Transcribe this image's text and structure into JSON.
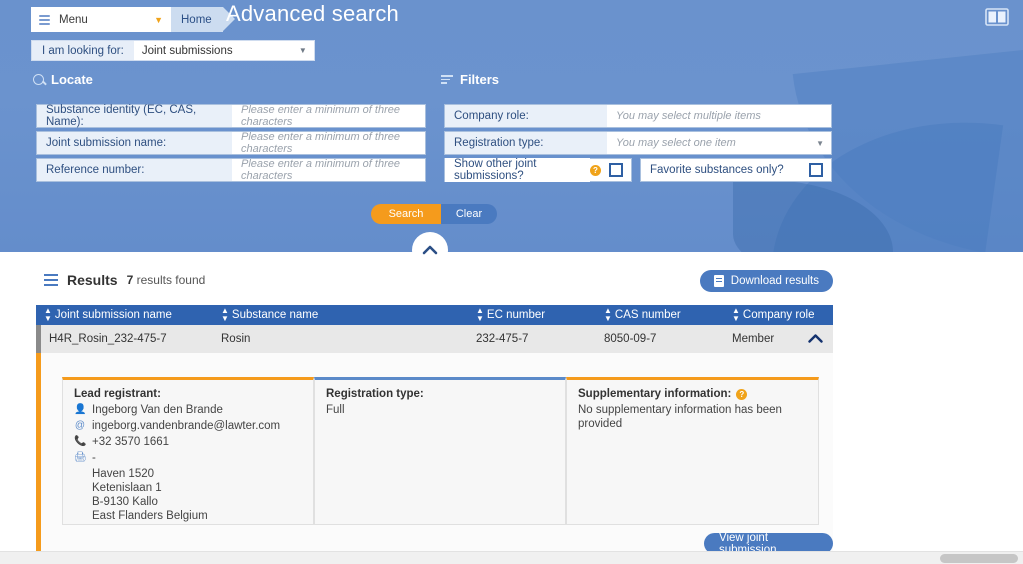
{
  "header": {
    "menu_label": "Menu",
    "menu_icon": "hamburger-icon",
    "caret_icon": "chevron-down-icon",
    "home_label": "Home",
    "page_title": "Advanced search",
    "book_icon": "book-panel-icon"
  },
  "lookingfor": {
    "label": "I am looking for:",
    "value": "Joint submissions",
    "caret": "▾"
  },
  "locate": {
    "heading": "Locate",
    "icon": "search-icon",
    "fields": [
      {
        "label": "Substance identity (EC, CAS, Name):",
        "placeholder": "Please enter a minimum of three characters",
        "value": ""
      },
      {
        "label": "Joint submission name:",
        "placeholder": "Please enter a minimum of three characters",
        "value": ""
      },
      {
        "label": "Reference number:",
        "placeholder": "Please enter a minimum of three characters",
        "value": ""
      }
    ]
  },
  "filters": {
    "heading": "Filters",
    "icon": "filter-icon",
    "company_role": {
      "label": "Company role:",
      "placeholder": "You may select multiple items",
      "value": ""
    },
    "registration_type": {
      "label": "Registration type:",
      "placeholder": "You may select one item",
      "value": "",
      "caret": "▾"
    },
    "show_other": {
      "label": "Show other joint submissions?",
      "info": "?",
      "checked": false
    },
    "favorite_only": {
      "label": "Favorite substances only?",
      "checked": false
    }
  },
  "actions": {
    "search_label": "Search",
    "clear_label": "Clear",
    "collapse_icon": "chevron-up-icon"
  },
  "results": {
    "title": "Results",
    "count": "7",
    "count_suffix": "results found",
    "list_icon": "list-icon",
    "download_label": "Download results",
    "download_icon": "document-icon",
    "columns": [
      "Joint submission name",
      "Substance name",
      "EC number",
      "CAS number",
      "Company role"
    ],
    "rows": [
      {
        "joint_submission_name": "H4R_Rosin_232-475-7",
        "substance_name": "Rosin",
        "ec_number": "232-475-7",
        "cas_number": "8050-09-7",
        "company_role": "Member",
        "collapse_icon": "chevron-up-icon"
      }
    ]
  },
  "detail": {
    "lead_registrant": {
      "title": "Lead registrant:",
      "person_icon": "person-icon",
      "name": "Ingeborg Van den Brande",
      "email_icon": "at-icon",
      "email": "ingeborg.vandenbrande@lawter.com",
      "phone_icon": "phone-icon",
      "phone": "+32 3570 1661",
      "fax_icon": "fax-icon",
      "fax": "-",
      "address": [
        "Haven 1520",
        "Ketenislaan 1",
        "B-9130 Kallo",
        "East Flanders Belgium"
      ]
    },
    "registration_type": {
      "title": "Registration type:",
      "value": "Full"
    },
    "supplementary": {
      "title": "Supplementary information:",
      "info": "?",
      "value": "No supplementary information has been provided"
    },
    "view_button": "View joint submission"
  },
  "colors": {
    "panel_blue": "#6b93ce",
    "table_header": "#2f63b0",
    "accent_orange": "#f59b1c",
    "button_blue": "#4a7ac0"
  }
}
